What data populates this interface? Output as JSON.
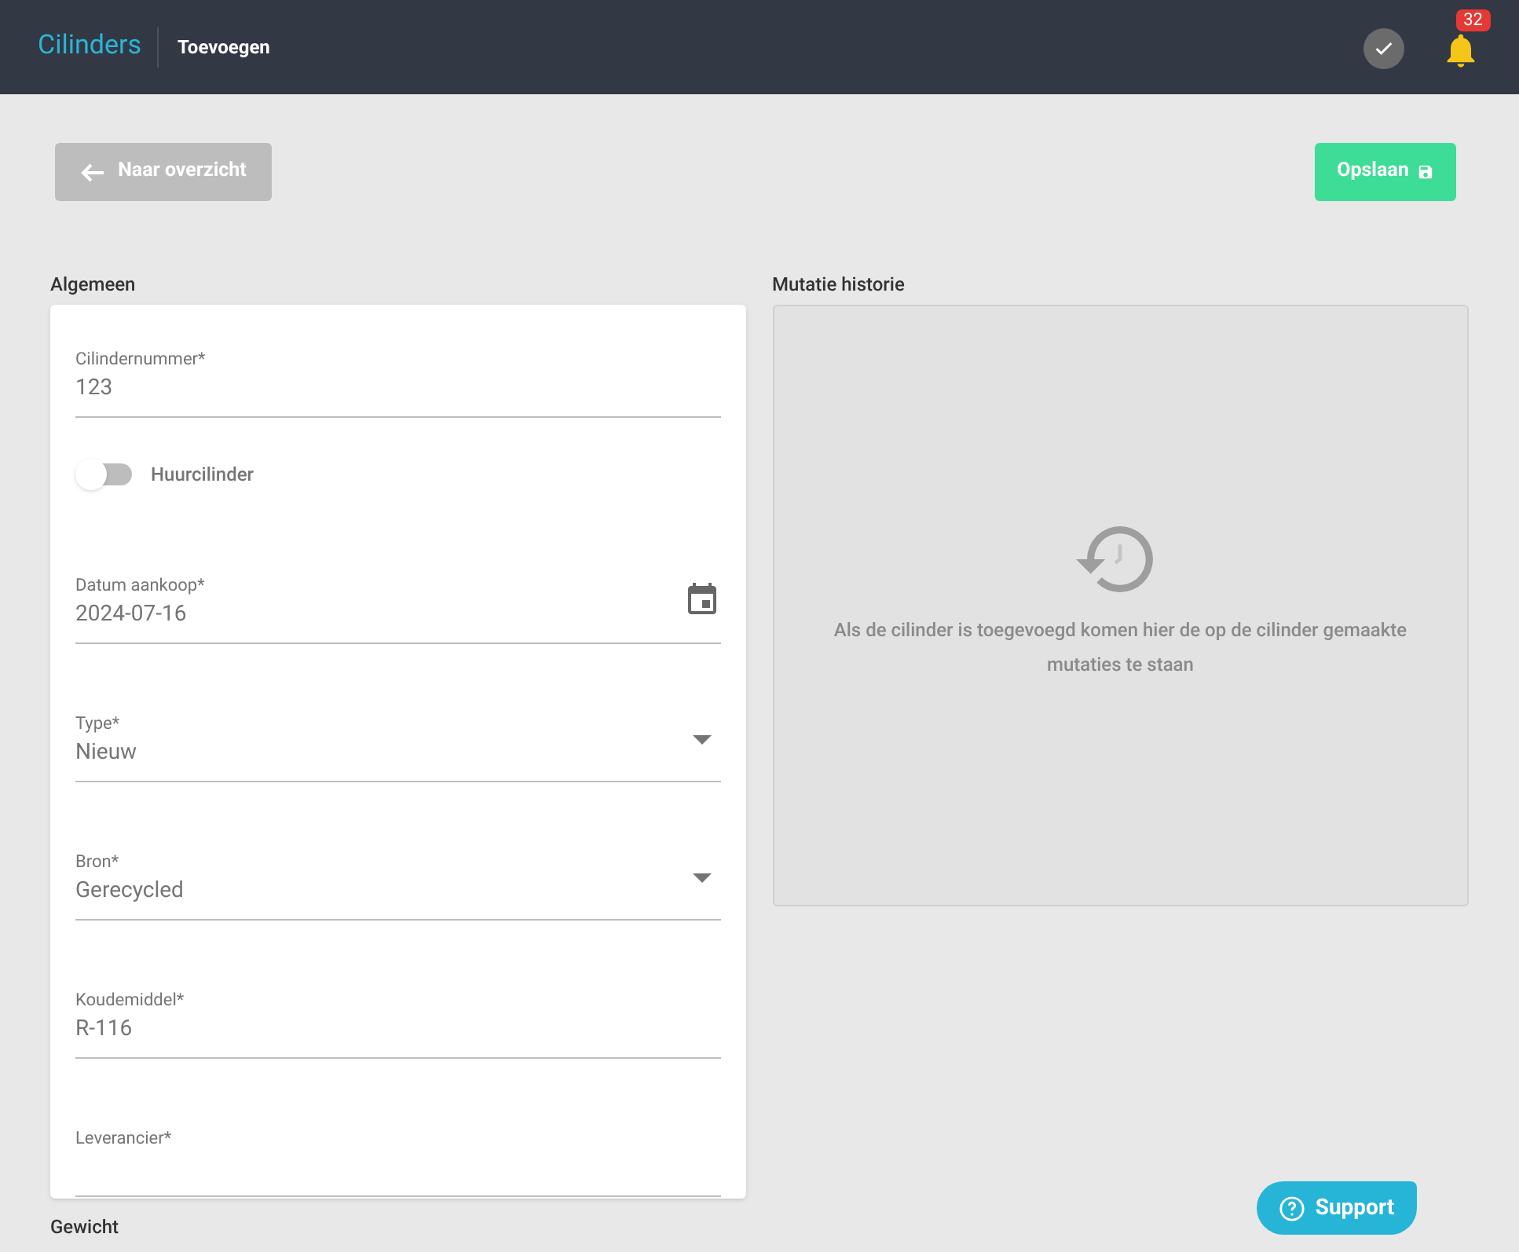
{
  "header": {
    "title": "Cilinders",
    "subtitle": "Toevoegen",
    "notifications": "32"
  },
  "actions": {
    "back": "Naar overzicht",
    "save": "Opslaan"
  },
  "general": {
    "title": "Algemeen",
    "fields": [
      {
        "kind": "text",
        "label": "Cilindernummer*",
        "value": "123"
      },
      {
        "kind": "toggle",
        "label": "Huurcilinder",
        "on": false
      },
      {
        "kind": "date",
        "label": "Datum aankoop*",
        "value": "2024-07-16"
      },
      {
        "kind": "select",
        "label": "Type*",
        "value": "Nieuw"
      },
      {
        "kind": "select",
        "label": "Bron*",
        "value": "Gerecycled"
      },
      {
        "kind": "text",
        "label": "Koudemiddel*",
        "value": "R-116"
      },
      {
        "kind": "text",
        "label": "Leverancier*"
      }
    ]
  },
  "history": {
    "title": "Mutatie historie",
    "empty_message": "Als de cilinder is toegevoegd komen hier de op de cilinder gemaakte mutaties te staan"
  },
  "next_section": {
    "title": "Gewicht"
  },
  "support": "Support"
}
